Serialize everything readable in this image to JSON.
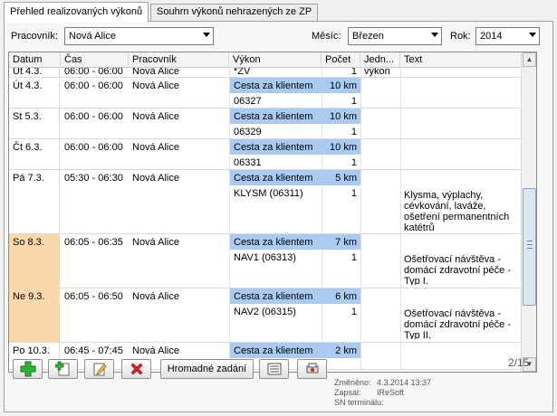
{
  "tabs": [
    {
      "label": "Přehled realizovaných výkonů",
      "active": true
    },
    {
      "label": "Souhrn výkonů nehrazených ze ZP",
      "active": false
    }
  ],
  "filters": {
    "worker_label": "Pracovník:",
    "worker_value": "Nová Alice",
    "month_label": "Měsíc:",
    "month_value": "Březen",
    "year_label": "Rok:",
    "year_value": "2014"
  },
  "grid": {
    "columns": [
      "Datum",
      "Čas",
      "Pracovník",
      "Výkon",
      "Počet",
      "Jedn...",
      "Text"
    ],
    "highlight_color": "#a9cbf1",
    "weekend_color": "#fbd7a9",
    "rows": [
      {
        "date": "Út 4.3.",
        "time": "06:00 - 06:00",
        "worker": "Nová Alice",
        "weekend": false,
        "items": [
          {
            "name": "*ZV",
            "count": "1",
            "unit": "výkon",
            "hl": false
          }
        ],
        "text": ""
      },
      {
        "date": "Út 4.3.",
        "time": "06:00 - 06:00",
        "worker": "Nová Alice",
        "weekend": false,
        "items": [
          {
            "name": "Cesta za klientem",
            "count": "10 km",
            "unit": "",
            "hl": true
          },
          {
            "name": "06327",
            "count": "1",
            "unit": "",
            "hl": false
          }
        ],
        "text": ""
      },
      {
        "date": "St 5.3.",
        "time": "06:00 - 06:00",
        "worker": "Nová Alice",
        "weekend": false,
        "items": [
          {
            "name": "Cesta za klientem",
            "count": "10 km",
            "unit": "",
            "hl": true
          },
          {
            "name": "06329",
            "count": "1",
            "unit": "",
            "hl": false
          }
        ],
        "text": ""
      },
      {
        "date": "Čt 6.3.",
        "time": "06:00 - 06:00",
        "worker": "Nová Alice",
        "weekend": false,
        "items": [
          {
            "name": "Cesta za klientem",
            "count": "10 km",
            "unit": "",
            "hl": true
          },
          {
            "name": "06331",
            "count": "1",
            "unit": "",
            "hl": false
          }
        ],
        "text": ""
      },
      {
        "date": "Pá 7.3.",
        "time": "05:30 - 06:30",
        "worker": "Nová Alice",
        "weekend": false,
        "items": [
          {
            "name": "Cesta za klientem",
            "count": "5 km",
            "unit": "",
            "hl": true
          },
          {
            "name": "KLYSM (06311)",
            "count": "1",
            "unit": "",
            "hl": false
          }
        ],
        "text": "Klysma, výplachy, cévkování, laváže, ošetření permanentních katétrů"
      },
      {
        "date": "So 8.3.",
        "time": "06:05 - 06:35",
        "worker": "Nová Alice",
        "weekend": true,
        "items": [
          {
            "name": "Cesta za klientem",
            "count": "7 km",
            "unit": "",
            "hl": true
          },
          {
            "name": "NAV1 (06313)",
            "count": "1",
            "unit": "",
            "hl": false
          }
        ],
        "text": "Ošetřovací návštěva - domácí zdravotní péče - Typ I."
      },
      {
        "date": "Ne 9.3.",
        "time": "06:05 - 06:50",
        "worker": "Nová Alice",
        "weekend": true,
        "items": [
          {
            "name": "Cesta za klientem",
            "count": "6 km",
            "unit": "",
            "hl": true
          },
          {
            "name": "NAV2 (06315)",
            "count": "1",
            "unit": "",
            "hl": false
          }
        ],
        "text": "Ošetřovací návštěva - domácí zdravotní péče - Typ II."
      },
      {
        "date": "Po 10.3.",
        "time": "06:45 - 07:45",
        "worker": "Nová Alice",
        "weekend": false,
        "items": [
          {
            "name": "Cesta za klientem",
            "count": "2 km",
            "unit": "",
            "hl": true
          }
        ],
        "text": ""
      }
    ]
  },
  "toolbar": {
    "add_icon": "plus-icon",
    "add_copy_icon": "add-copy-icon",
    "edit_icon": "edit-icon",
    "delete_icon": "delete-icon",
    "bulk_assign_label": "Hromadné zadání",
    "list_icon": "list-icon",
    "print_icon": "print-icon"
  },
  "meta": {
    "changed_label": "Změněno:",
    "changed_value": "4.3.2014 13:37",
    "written_label": "Zapsal:",
    "written_value": "IReSoft",
    "sn_label": "SN terminálu:",
    "sn_value": ""
  },
  "pager": "2/15"
}
